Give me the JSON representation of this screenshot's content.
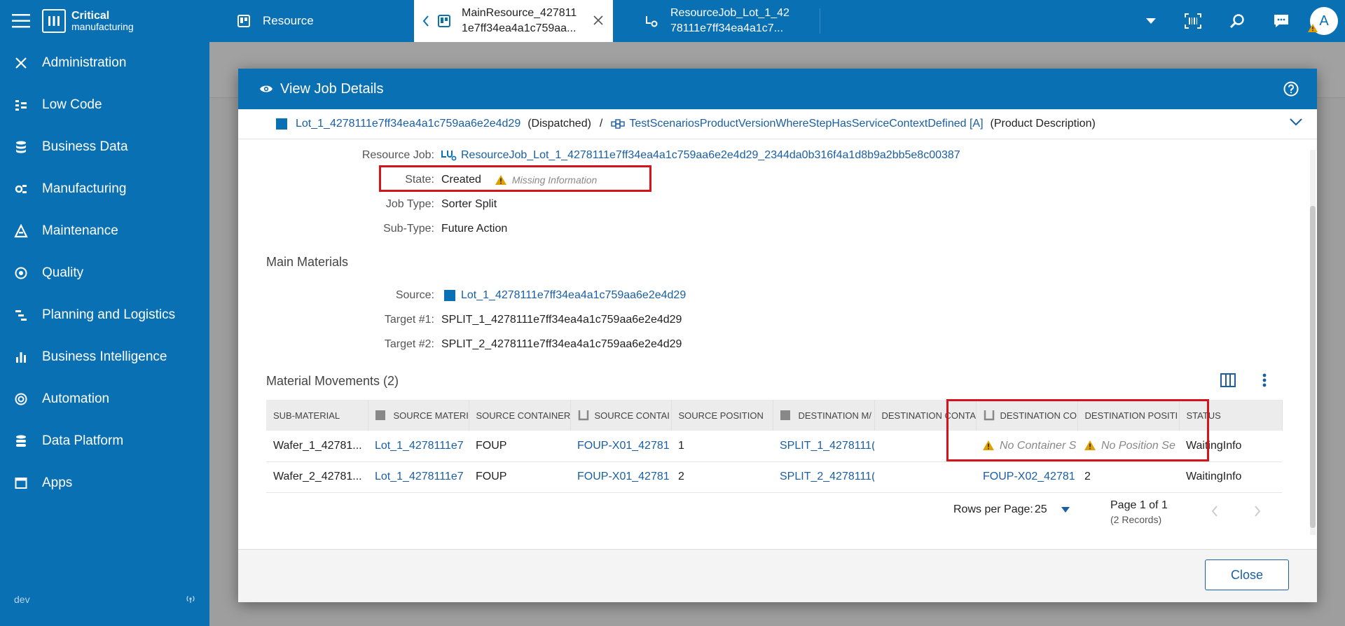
{
  "app": {
    "brand_line1": "Critical",
    "brand_line2": "manufacturing",
    "env": "dev"
  },
  "sidebar": {
    "items": [
      {
        "label": "Administration",
        "icon": "tools-icon"
      },
      {
        "label": "Low Code",
        "icon": "lowcode-icon"
      },
      {
        "label": "Business Data",
        "icon": "database-icon"
      },
      {
        "label": "Manufacturing",
        "icon": "manufacturing-icon"
      },
      {
        "label": "Maintenance",
        "icon": "maintenance-icon"
      },
      {
        "label": "Quality",
        "icon": "quality-icon"
      },
      {
        "label": "Planning and Logistics",
        "icon": "planning-icon"
      },
      {
        "label": "Business Intelligence",
        "icon": "chart-icon"
      },
      {
        "label": "Automation",
        "icon": "automation-icon"
      },
      {
        "label": "Data Platform",
        "icon": "data-platform-icon"
      },
      {
        "label": "Apps",
        "icon": "apps-icon"
      }
    ]
  },
  "tabs": [
    {
      "label": "Resource"
    },
    {
      "line1": "MainResource_427811",
      "line2": "1e7ff34ea4a1c759aa..."
    },
    {
      "line1": "ResourceJob_Lot_1_42",
      "line2": "78111e7ff34ea4a1c7..."
    }
  ],
  "user": {
    "avatar": "A"
  },
  "modal": {
    "title": "View Job Details",
    "breadcrumb": {
      "lot": "Lot_1_4278111e7ff34ea4a1c759aa6e2e4d29",
      "lot_state": "(Dispatched)",
      "sep": "/",
      "product": "TestScenariosProductVersionWhereStepHasServiceContextDefined [A]",
      "product_desc": "(Product Description)"
    },
    "fields": {
      "resource_job_label": "Resource Job:",
      "resource_job_value": "ResourceJob_Lot_1_4278111e7ff34ea4a1c759aa6e2e4d29_2344da0b316f4a1d8b9a2bb5e8c00387",
      "state_label": "State:",
      "state_value": "Created",
      "state_warning": "Missing Information",
      "job_type_label": "Job Type:",
      "job_type_value": "Sorter Split",
      "subtype_label": "Sub-Type:",
      "subtype_value": "Future Action"
    },
    "main_materials": {
      "title": "Main Materials",
      "source_label": "Source:",
      "source_value": "Lot_1_4278111e7ff34ea4a1c759aa6e2e4d29",
      "target1_label": "Target #1:",
      "target1_value": "SPLIT_1_4278111e7ff34ea4a1c759aa6e2e4d29",
      "target2_label": "Target #2:",
      "target2_value": "SPLIT_2_4278111e7ff34ea4a1c759aa6e2e4d29"
    },
    "movements": {
      "title": "Material Movements (2)",
      "columns": [
        "SUB-MATERIAL",
        "SOURCE MATERI",
        "SOURCE CONTAINER",
        "SOURCE CONTAI",
        "SOURCE POSITION",
        "DESTINATION M/",
        "DESTINATION CONTA",
        "DESTINATION CO",
        "DESTINATION POSITI",
        "STATUS"
      ],
      "rows": [
        [
          "Wafer_1_42781...",
          "Lot_1_4278111e7",
          "FOUP",
          "FOUP-X01_42781",
          "1",
          "SPLIT_1_4278111(",
          "",
          "No Container S",
          "No Position Se",
          "WaitingInfo"
        ],
        [
          "Wafer_2_42781...",
          "Lot_1_4278111e7",
          "FOUP",
          "FOUP-X01_42781",
          "2",
          "SPLIT_2_4278111(",
          "",
          "FOUP-X02_42781",
          "2",
          "WaitingInfo"
        ]
      ],
      "rows_per_page_label": "Rows per Page:",
      "rows_per_page_value": "25",
      "page_info": "Page 1 of 1",
      "records": "(2 Records)"
    },
    "close_label": "Close"
  },
  "colors": {
    "brand": "#0a70b4",
    "link": "#1a5fa3",
    "highlight": "#d4131b",
    "warning": "#e0a100"
  }
}
